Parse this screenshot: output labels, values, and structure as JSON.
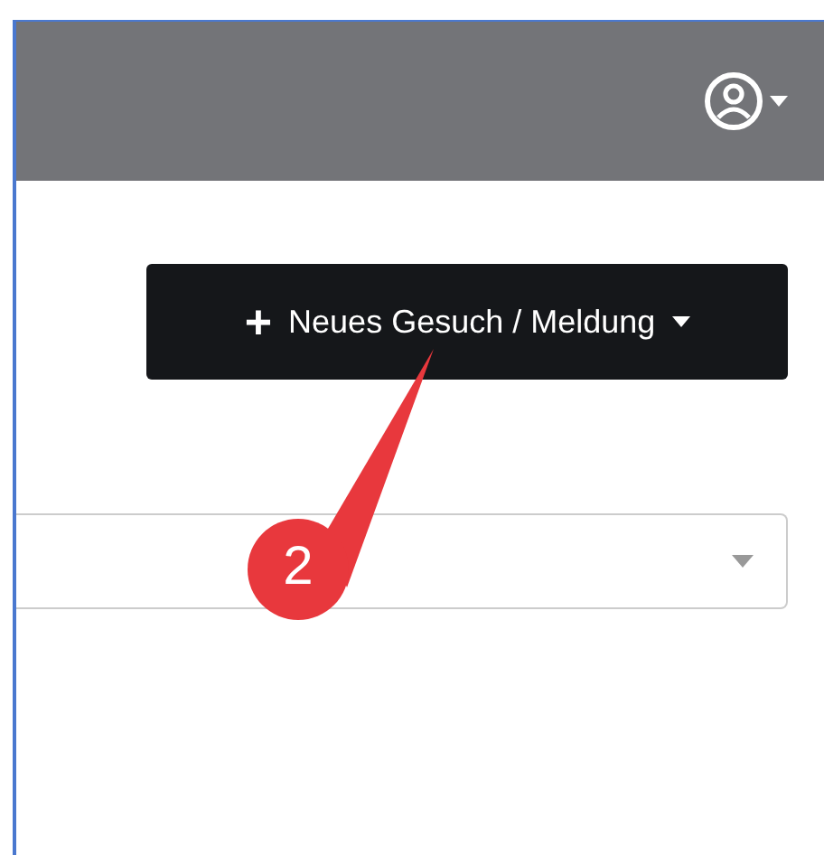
{
  "new_request_button": {
    "icon": "+",
    "label": "Neues Gesuch / Meldung"
  },
  "callout": {
    "number": "2"
  }
}
